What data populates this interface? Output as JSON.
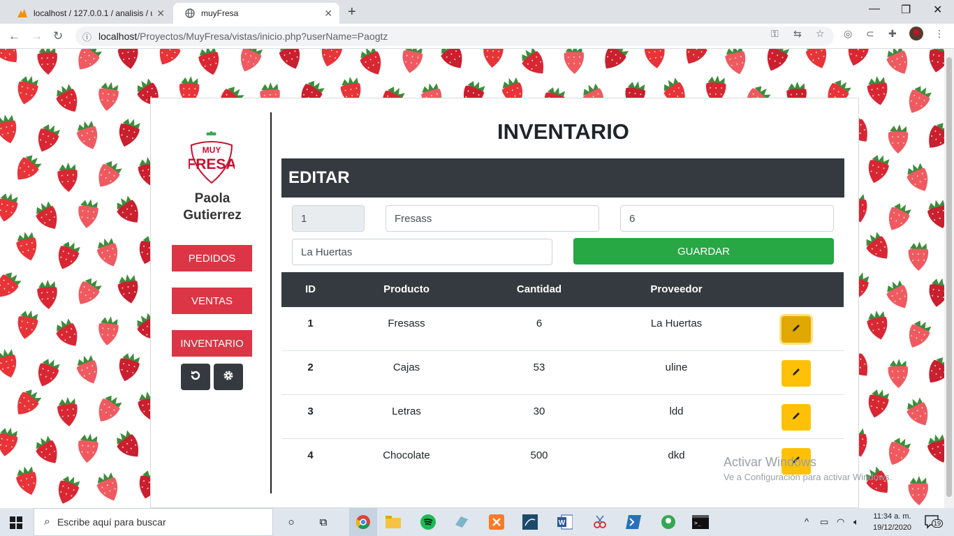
{
  "browser": {
    "tabs": [
      {
        "title": "localhost / 127.0.0.1 / analisis / u",
        "active": false
      },
      {
        "title": "muyFresa",
        "active": true
      }
    ],
    "url_host": "localhost",
    "url_path": "/Proyectos/MuyFresa/vistas/inicio.php?userName=Paogtz"
  },
  "sidebar": {
    "logo_text_top": "MUY",
    "logo_text_bottom": "FRESA",
    "user_first": "Paola",
    "user_last": "Gutierrez",
    "nav": [
      "PEDIDOS",
      "VENTAS",
      "INVENTARIO"
    ]
  },
  "main": {
    "title": "INVENTARIO",
    "edit_header": "EDITAR",
    "form": {
      "id_value": "1",
      "product_value": "Fresass",
      "quantity_value": "6",
      "supplier_value": "La Huertas",
      "save_label": "GUARDAR"
    },
    "table": {
      "headers": [
        "ID",
        "Producto",
        "Cantidad",
        "Proveedor"
      ],
      "rows": [
        {
          "id": "1",
          "producto": "Fresass",
          "cantidad": "6",
          "proveedor": "La Huertas"
        },
        {
          "id": "2",
          "producto": "Cajas",
          "cantidad": "53",
          "proveedor": "uline"
        },
        {
          "id": "3",
          "producto": "Letras",
          "cantidad": "30",
          "proveedor": "ldd"
        },
        {
          "id": "4",
          "producto": "Chocolate",
          "cantidad": "500",
          "proveedor": "dkd"
        }
      ]
    }
  },
  "watermark": {
    "line1": "Activar Windows",
    "line2": "Ve a Configuración para activar Windows."
  },
  "taskbar": {
    "search_placeholder": "Escribe aquí para buscar",
    "time": "11:34 a. m.",
    "date": "19/12/2020",
    "notification_count": "19"
  },
  "colors": {
    "nav_red": "#dc3545",
    "dark": "#343a40",
    "save_green": "#28a745",
    "edit_yellow": "#ffc107",
    "brand_red": "#c8102e"
  }
}
